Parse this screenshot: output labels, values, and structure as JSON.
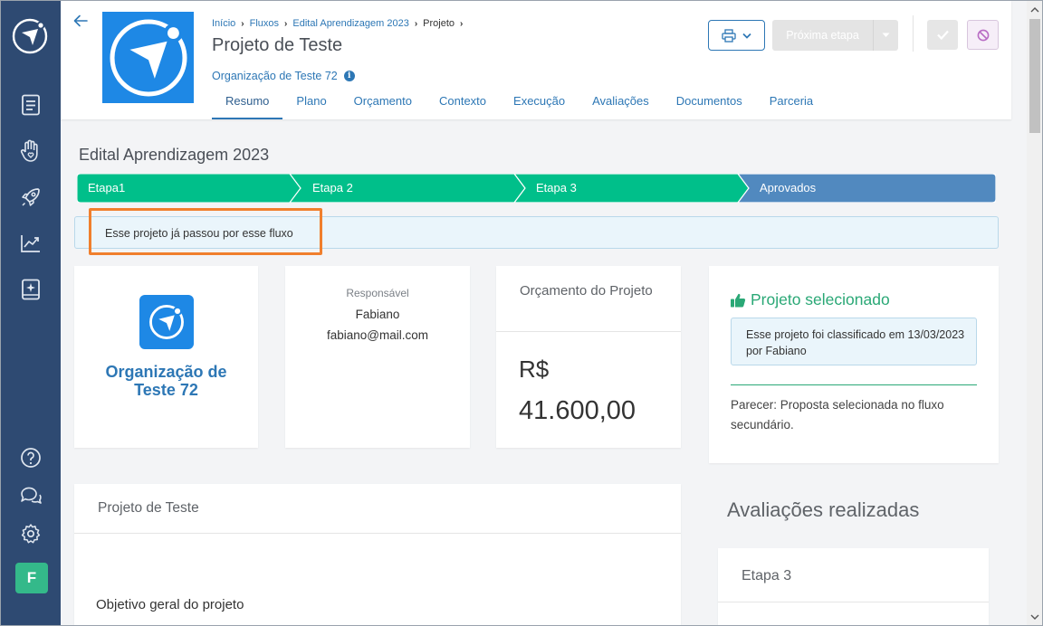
{
  "sidebar": {
    "items": [
      {
        "icon": "document-icon"
      },
      {
        "icon": "hand-heart-icon"
      },
      {
        "icon": "rocket-icon"
      },
      {
        "icon": "chart-line-icon"
      },
      {
        "icon": "book-sparkle-icon"
      }
    ],
    "bottom": [
      {
        "icon": "help-icon"
      },
      {
        "icon": "chat-icon"
      },
      {
        "icon": "gear-icon"
      }
    ],
    "avatar_letter": "F",
    "avatar_color": "#34b98a",
    "background": "#2e4a72"
  },
  "header": {
    "breadcrumb": [
      "Início",
      "Fluxos",
      "Edital Aprendizagem 2023",
      "Projeto"
    ],
    "title": "Projeto de Teste",
    "organization": "Organização de Teste 72",
    "tabs": [
      "Resumo",
      "Plano",
      "Orçamento",
      "Contexto",
      "Execução",
      "Avaliações",
      "Documentos",
      "Parceria"
    ],
    "active_tab": "Resumo",
    "next_step_label": "Próxima etapa"
  },
  "flow": {
    "title": "Edital Aprendizagem 2023",
    "steps": [
      {
        "label": "Etapa1",
        "status": "done"
      },
      {
        "label": "Etapa 2",
        "status": "done"
      },
      {
        "label": "Etapa 3",
        "status": "done"
      },
      {
        "label": "Aprovados",
        "status": "current"
      }
    ],
    "done_color": "#00bf8a",
    "current_color": "#5189bf",
    "alert": "Esse projeto já passou por esse fluxo"
  },
  "org_card": {
    "name": "Organização de Teste 72"
  },
  "responsible": {
    "label": "Responsável",
    "name": "Fabiano",
    "email": "fabiano@mail.com"
  },
  "budget": {
    "title": "Orçamento do Projeto",
    "currency": "R$",
    "value": "41.600,00"
  },
  "selection": {
    "title": "Projeto selecionado",
    "message": "Esse projeto foi classificado em 13/03/2023 por Fabiano",
    "opinion": "Parecer: Proposta selecionada no fluxo secundário.",
    "color": "#2aa876"
  },
  "project": {
    "title": "Projeto de Teste",
    "objective_label": "Objetivo geral do projeto"
  },
  "evaluations": {
    "title": "Avaliações realizadas",
    "stage": "Etapa 3"
  },
  "colors": {
    "link": "#2d77b5",
    "highlight": "#f07f2d"
  }
}
